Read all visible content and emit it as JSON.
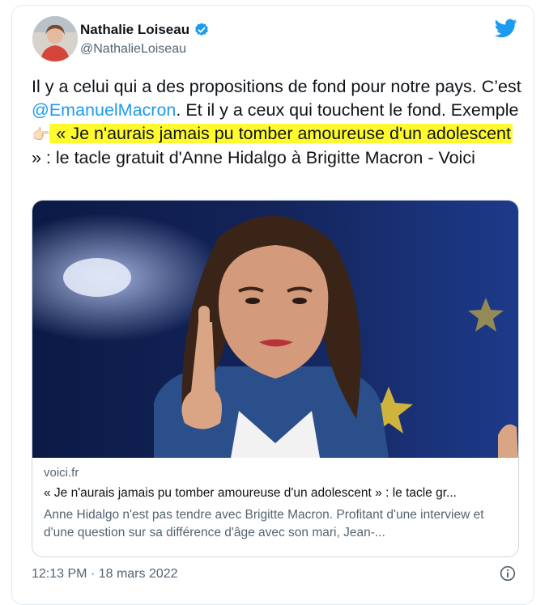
{
  "author": {
    "display_name": "Nathalie Loiseau",
    "handle": "@NathalieLoiseau",
    "verified": true
  },
  "tweet": {
    "text_1": "Il y a celui qui a des propositions de fond pour notre pays. C’est ",
    "mention": "@EmanuelMacron",
    "text_2": ". Et il y a ceux qui touchent le fond. Exemple",
    "emoji": "👉🏻",
    "highlighted": " « Je n'aurais jamais pu tomber amoureuse d'un adolescent",
    "text_3": " » : le tacle gratuit d'Anne Hidalgo à Brigitte Macron - Voici",
    "highlight_color": "#fffa2e",
    "mention_color": "#1d9bf0"
  },
  "link_card": {
    "domain": "voici.fr",
    "title": "« Je n'aurais jamais pu tomber amoureuse d'un adolescent » : le tacle gr...",
    "description": "Anne Hidalgo n'est pas tendre avec Brigitte Macron. Profitant d'une interview et d'une question sur sa différence d'âge avec son mari, Jean-..."
  },
  "footer": {
    "timestamp": "12:13 PM · 18 mars 2022"
  },
  "icons": {
    "platform": "twitter-bird-icon",
    "verified": "verified-badge-icon",
    "info": "info-icon"
  },
  "colors": {
    "brand": "#1d9bf0",
    "secondary_text": "#536471"
  }
}
